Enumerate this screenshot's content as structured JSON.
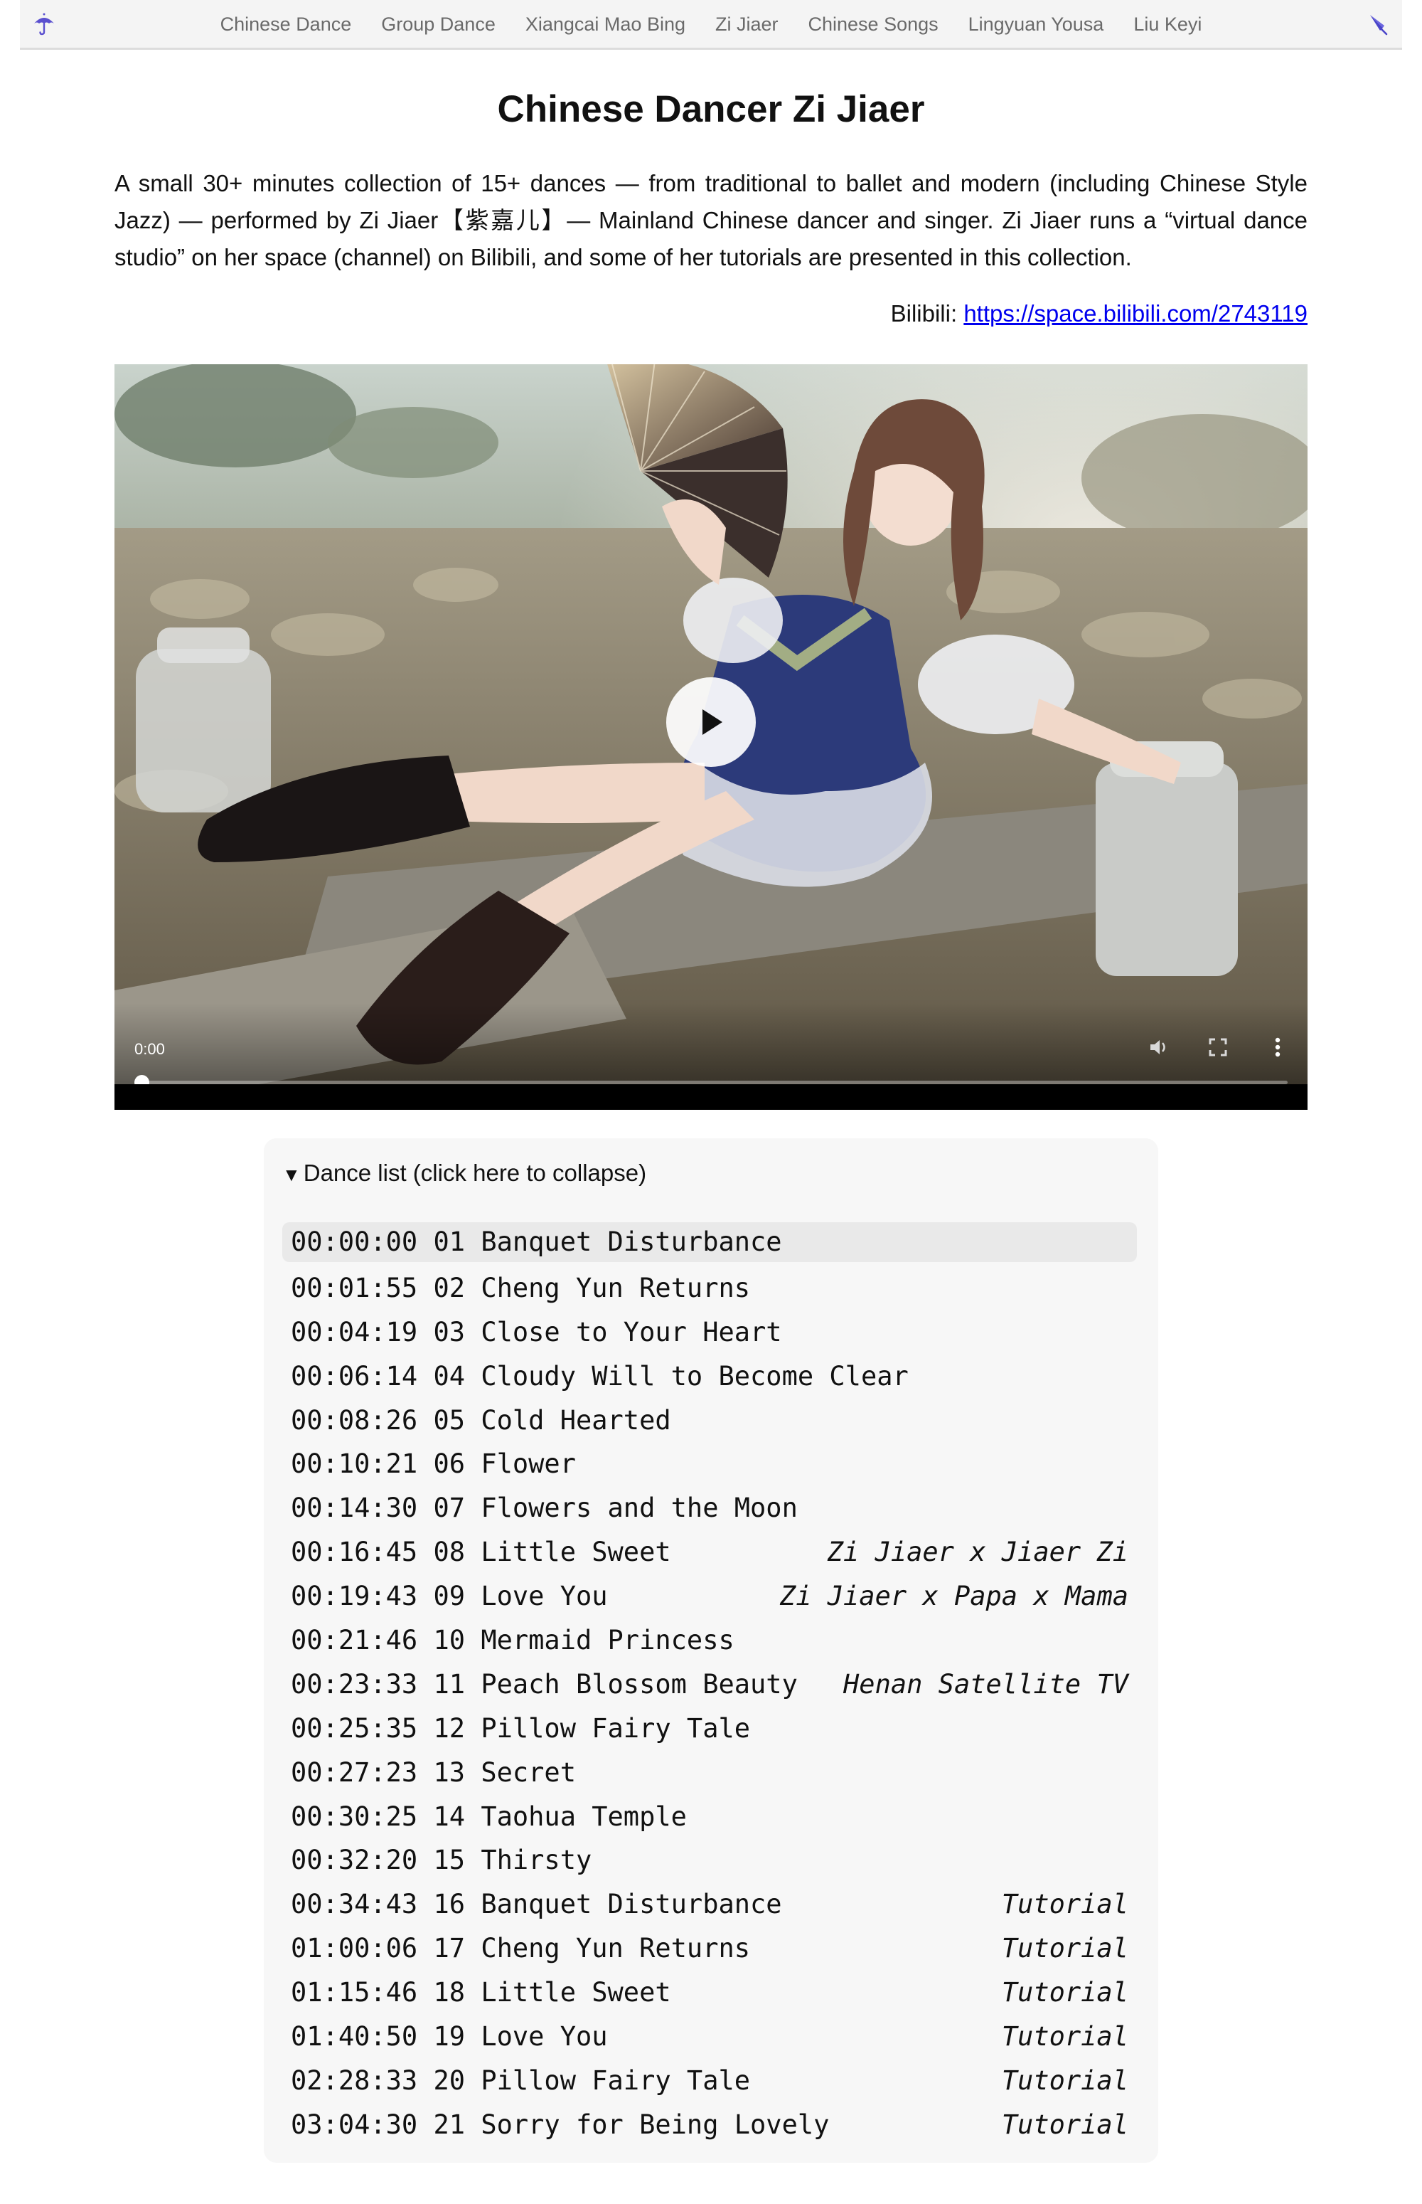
{
  "nav": {
    "links": [
      "Chinese Dance",
      "Group Dance",
      "Xiangcai Mao Bing",
      "Zi Jiaer",
      "Chinese Songs",
      "Lingyuan Yousa",
      "Liu Keyi"
    ],
    "left_icon": "umbrella-icon",
    "right_icon": "closed-umbrella-icon"
  },
  "title": "Chinese Dancer Zi Jiaer",
  "intro": "A small 30+ minutes collection of 15+ dances — from traditional to ballet and modern (including Chinese Style Jazz) — performed by Zi Jiaer【紫嘉儿】— Mainland Chinese dancer and singer. Zi Jiaer runs a “virtual dance studio” on her space (channel) on Bilibili, and some of her tutorials are presented in this collection.",
  "bilibili": {
    "label": "Bilibili: ",
    "url": "https://space.bilibili.com/2743119"
  },
  "video": {
    "time": "0:00",
    "progress": 0,
    "icons": [
      "play-icon",
      "volume-icon",
      "fullscreen-icon",
      "more-options-icon"
    ]
  },
  "dance_list": {
    "summary": "Dance list (click here to collapse)",
    "items": [
      {
        "time": "00:00:00",
        "label": "01 Banquet Disturbance",
        "note": ""
      },
      {
        "time": "00:01:55",
        "label": "02 Cheng Yun Returns",
        "note": ""
      },
      {
        "time": "00:04:19",
        "label": "03 Close to Your Heart",
        "note": ""
      },
      {
        "time": "00:06:14",
        "label": "04 Cloudy Will to Become Clear",
        "note": ""
      },
      {
        "time": "00:08:26",
        "label": "05 Cold Hearted",
        "note": ""
      },
      {
        "time": "00:10:21",
        "label": "06 Flower",
        "note": ""
      },
      {
        "time": "00:14:30",
        "label": "07 Flowers and the Moon",
        "note": ""
      },
      {
        "time": "00:16:45",
        "label": "08 Little Sweet",
        "note": "Zi Jiaer x Jiaer Zi"
      },
      {
        "time": "00:19:43",
        "label": "09 Love You",
        "note": "Zi Jiaer x Papa x Mama"
      },
      {
        "time": "00:21:46",
        "label": "10 Mermaid Princess",
        "note": ""
      },
      {
        "time": "00:23:33",
        "label": "11 Peach Blossom Beauty",
        "note": "Henan Satellite TV"
      },
      {
        "time": "00:25:35",
        "label": "12 Pillow Fairy Tale",
        "note": ""
      },
      {
        "time": "00:27:23",
        "label": "13 Secret",
        "note": ""
      },
      {
        "time": "00:30:25",
        "label": "14 Taohua Temple",
        "note": ""
      },
      {
        "time": "00:32:20",
        "label": "15 Thirsty",
        "note": ""
      },
      {
        "time": "00:34:43",
        "label": "16 Banquet Disturbance",
        "note": "Tutorial"
      },
      {
        "time": "01:00:06",
        "label": "17 Cheng Yun Returns",
        "note": "Tutorial"
      },
      {
        "time": "01:15:46",
        "label": "18 Little Sweet",
        "note": "Tutorial"
      },
      {
        "time": "01:40:50",
        "label": "19 Love You",
        "note": "Tutorial"
      },
      {
        "time": "02:28:33",
        "label": "20 Pillow Fairy Tale",
        "note": "Tutorial"
      },
      {
        "time": "03:04:30",
        "label": "21 Sorry for Being Lovely",
        "note": "Tutorial"
      }
    ]
  },
  "colors": {
    "link": "#0000ee",
    "nav_text": "#6a6a6a",
    "list_bg": "#f7f7f7",
    "active_row": "#e9e9e9"
  }
}
